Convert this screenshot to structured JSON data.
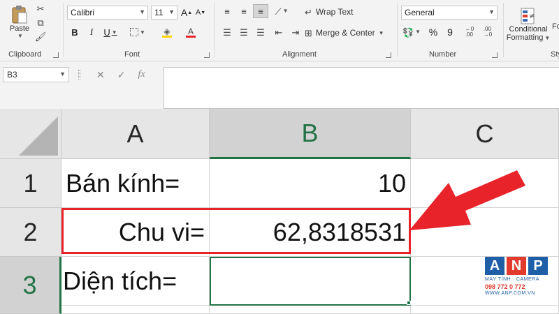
{
  "ribbon": {
    "clipboard": {
      "label": "Clipboard",
      "paste": "Paste"
    },
    "font": {
      "label": "Font",
      "name": "Calibri",
      "size": "11",
      "bold": "B",
      "italic": "I",
      "underline": "U",
      "grow": "A",
      "shrink": "A"
    },
    "alignment": {
      "label": "Alignment",
      "wrap_text": "Wrap Text",
      "merge_center": "Merge & Center"
    },
    "number": {
      "label": "Number",
      "format": "General",
      "percent": "%",
      "comma": "9"
    },
    "styles": {
      "conditional_line1": "Conditional",
      "conditional_line2": "Formatting",
      "next_line1": "Fo",
      "label": "Sty"
    }
  },
  "formula_bar": {
    "name_box": "B3",
    "cancel": "✕",
    "enter": "✓",
    "fx": "fx",
    "value": ""
  },
  "grid": {
    "columns": [
      "A",
      "B",
      "C"
    ],
    "rows": [
      "1",
      "2",
      "3"
    ],
    "cells": {
      "A1": "Bán kính=",
      "B1": "10",
      "A2": "Chu vi=",
      "B2": "62,8318531",
      "A3": "Diện tích=",
      "B3": ""
    },
    "selected_cell": "B3"
  },
  "watermark": {
    "a": "A",
    "n": "N",
    "p": "P",
    "tagline": "MÁY TÍNH · CAMERA",
    "phone": "098 772 0 772",
    "site": "WWW.ANP.COM.VN"
  },
  "colors": {
    "accent": "#217346",
    "highlight": "#e8232a",
    "arrow": "#e8232a"
  }
}
